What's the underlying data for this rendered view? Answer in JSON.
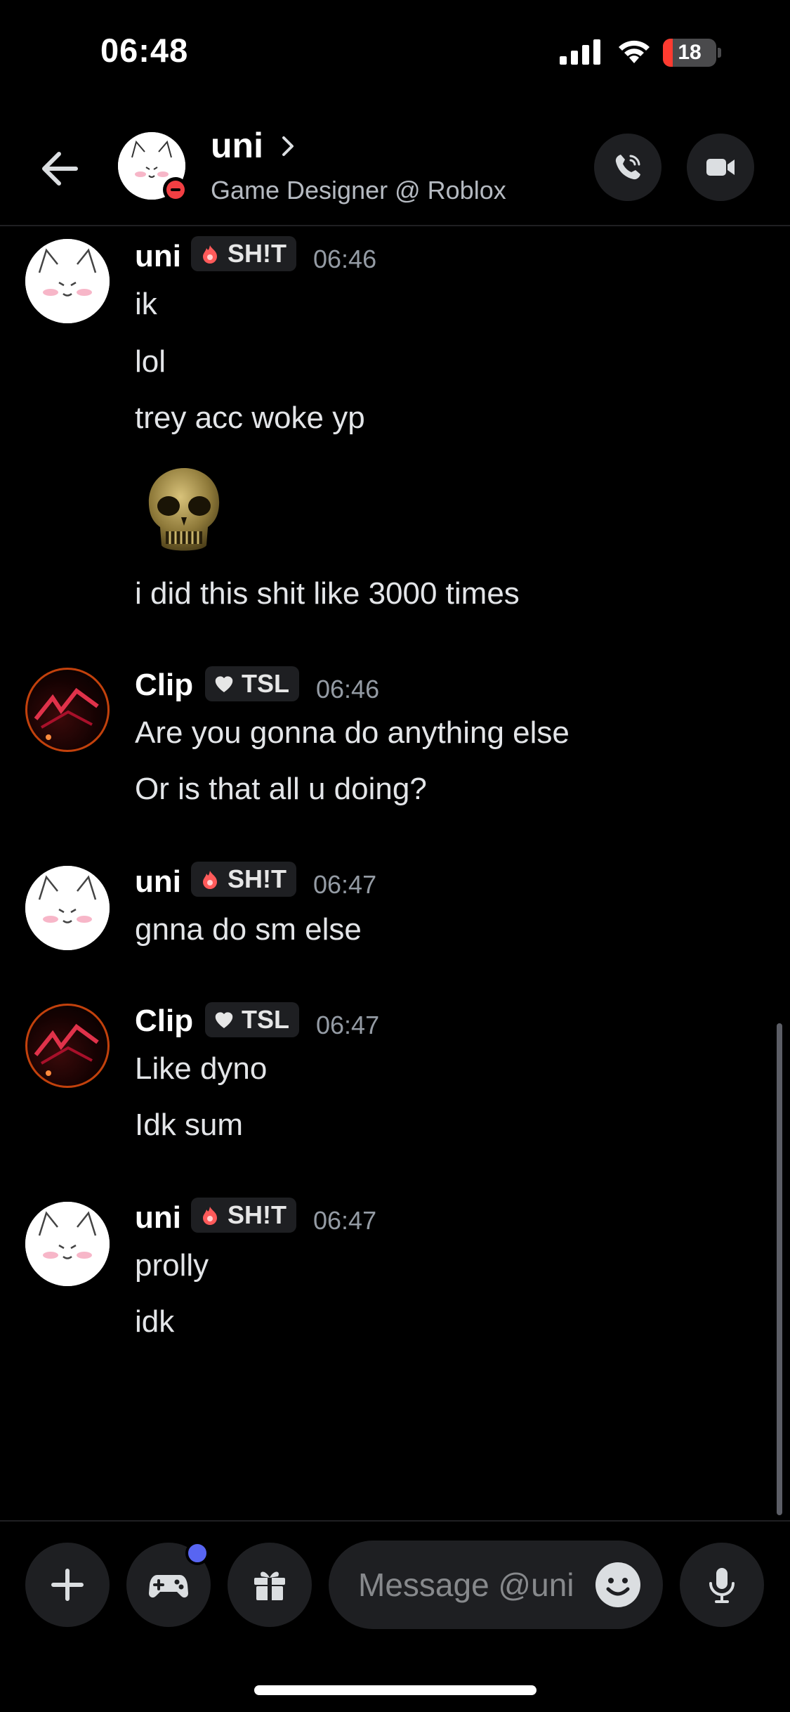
{
  "status_bar": {
    "time": "06:48",
    "battery": "18",
    "battery_level_percent": 18,
    "icons": [
      "cellular-signal-icon",
      "wifi-icon",
      "battery-charging-icon"
    ]
  },
  "header": {
    "name": "uni",
    "subtitle": "Game Designer @ Roblox",
    "status": "do-not-disturb",
    "icons": [
      "back-arrow-icon",
      "chevron-right-icon",
      "phone-icon",
      "video-icon"
    ]
  },
  "messages": [
    {
      "author": "uni",
      "tag": "SH!T",
      "tag_icon": "fire-icon",
      "time": "06:46",
      "lines": [
        "ik",
        "lol",
        "trey acc woke yp"
      ],
      "emoji": "skull-emoji",
      "after_emoji": "i did this shit like 3000 times"
    },
    {
      "author": "Clip",
      "tag": "TSL",
      "tag_icon": "heart-icon",
      "time": "06:46",
      "lines": [
        "Are you gonna do anything else",
        "Or is that all u doing?"
      ]
    },
    {
      "author": "uni",
      "tag": "SH!T",
      "tag_icon": "fire-icon",
      "time": "06:47",
      "lines": [
        "gnna do sm else"
      ]
    },
    {
      "author": "Clip",
      "tag": "TSL",
      "tag_icon": "heart-icon",
      "time": "06:47",
      "lines": [
        "Like dyno",
        "Idk sum"
      ]
    },
    {
      "author": "uni",
      "tag": "SH!T",
      "tag_icon": "fire-icon",
      "time": "06:47",
      "lines": [
        "prolly",
        "idk"
      ]
    }
  ],
  "composer": {
    "placeholder": "Message @uni",
    "icons": [
      "plus-icon",
      "gamepad-icon",
      "gift-icon",
      "emoji-icon",
      "microphone-icon"
    ]
  },
  "colors": {
    "background": "#000000",
    "surface": "#1e1f22",
    "accent": "#5865f2",
    "battery_low": "#ff3b30",
    "dnd": "#f23f43"
  }
}
